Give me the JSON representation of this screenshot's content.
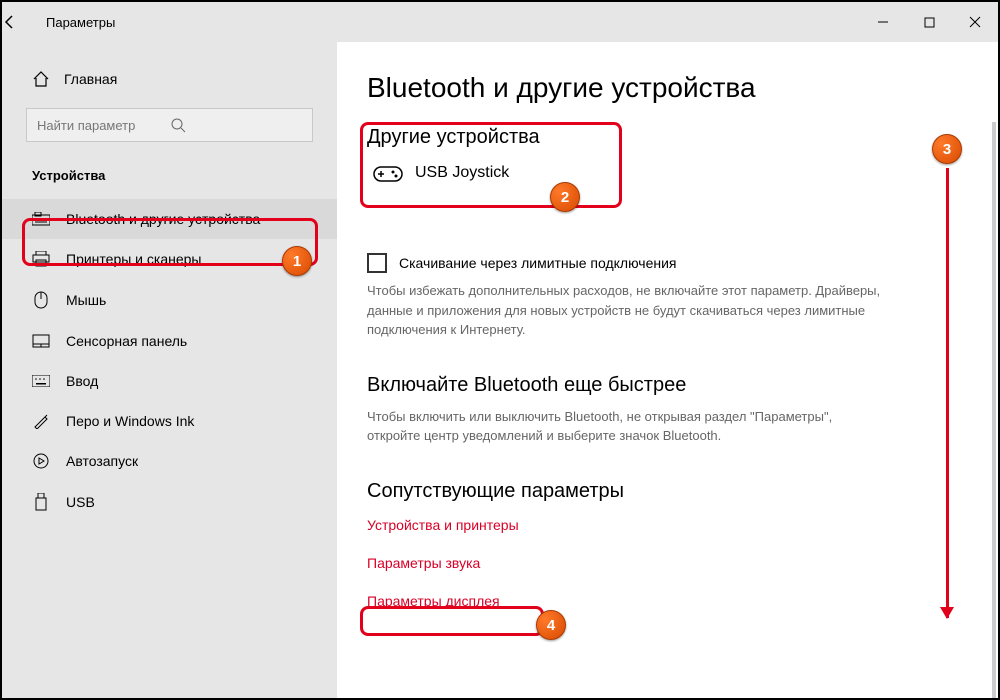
{
  "window": {
    "title": "Параметры"
  },
  "sidebar": {
    "home": "Главная",
    "search_placeholder": "Найти параметр",
    "section": "Устройства",
    "items": [
      {
        "label": "Bluetooth и другие устройства",
        "icon": "keyboard-icon",
        "selected": true
      },
      {
        "label": "Принтеры и сканеры",
        "icon": "printer-icon"
      },
      {
        "label": "Мышь",
        "icon": "mouse-icon"
      },
      {
        "label": "Сенсорная панель",
        "icon": "touchpad-icon"
      },
      {
        "label": "Ввод",
        "icon": "typing-icon"
      },
      {
        "label": "Перо и Windows Ink",
        "icon": "pen-icon"
      },
      {
        "label": "Автозапуск",
        "icon": "autoplay-icon"
      },
      {
        "label": "USB",
        "icon": "usb-icon"
      }
    ]
  },
  "main": {
    "title": "Bluetooth и другие устройства",
    "other_heading": "Другие устройства",
    "device": {
      "name": "USB  Joystick"
    },
    "metered_label": "Скачивание через лимитные подключения",
    "metered_help": "Чтобы избежать дополнительных расходов, не включайте этот параметр. Драйверы, данные и приложения для новых устройств не будут скачиваться через лимитные подключения к Интернету.",
    "faster_heading": "Включайте Bluetooth еще быстрее",
    "faster_help": "Чтобы включить или выключить Bluetooth, не открывая раздел \"Параметры\", откройте центр уведомлений и выберите значок Bluetooth.",
    "related_heading": "Сопутствующие параметры",
    "links": {
      "devices": "Устройства и принтеры",
      "sound": "Параметры звука",
      "display": "Параметры дисплея"
    }
  },
  "annotations": {
    "b1": "1",
    "b2": "2",
    "b3": "3",
    "b4": "4"
  }
}
